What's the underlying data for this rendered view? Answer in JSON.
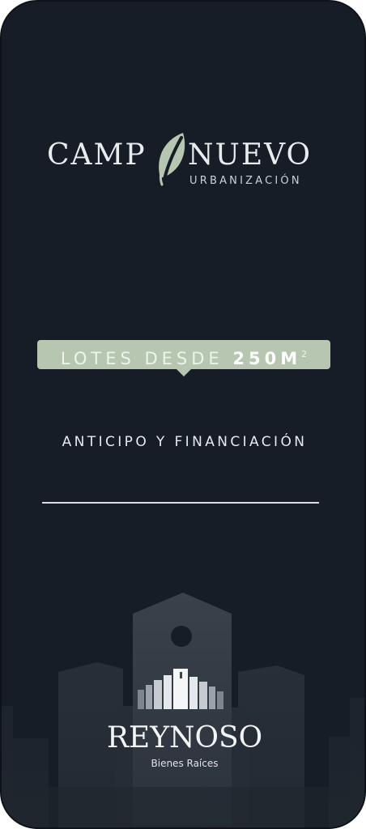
{
  "brand": {
    "name_left": "CAMP",
    "name_right": "NUEVO",
    "subtitle": "URBANIZACIÓN"
  },
  "badge": {
    "prefix": "LOTES DESDE ",
    "value": "250M",
    "superscript": "2"
  },
  "offer": {
    "text": "ANTICIPO Y FINANCIACIÓN"
  },
  "footer_brand": {
    "name": "REYNOSO",
    "tagline": "Bienes Raíces"
  },
  "colors": {
    "background": "#161d26",
    "badge": "#b6c6b0",
    "leaf": "#b6c6b0",
    "text": "#e8ecef"
  },
  "icons": {
    "leaf": "leaf-icon",
    "skyline": "city-skyline-graphic",
    "reynoso_logo": "building-logo-icon"
  }
}
